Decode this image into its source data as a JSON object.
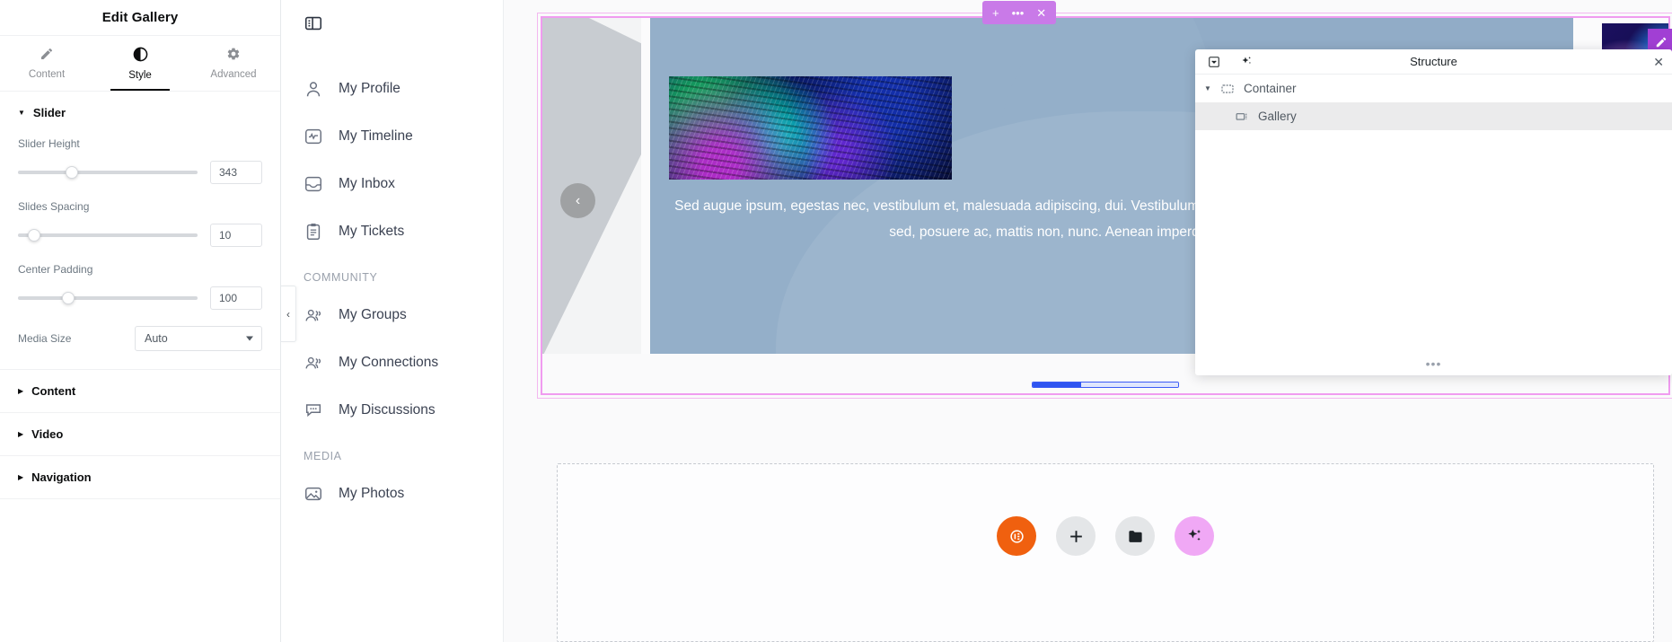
{
  "panel": {
    "title": "Edit Gallery",
    "tabs": [
      {
        "label": "Content",
        "icon": "pencil-icon",
        "active": false
      },
      {
        "label": "Style",
        "icon": "contrast-icon",
        "active": true
      },
      {
        "label": "Advanced",
        "icon": "gear-icon",
        "active": false
      }
    ],
    "sections": [
      {
        "name": "Slider",
        "expanded": true
      },
      {
        "name": "Content",
        "expanded": false
      },
      {
        "name": "Video",
        "expanded": false
      },
      {
        "name": "Navigation",
        "expanded": false
      }
    ],
    "slider_controls": [
      {
        "label": "Slider Height",
        "value": "343",
        "knob_pct": 30
      },
      {
        "label": "Slides Spacing",
        "value": "10",
        "knob_pct": 9
      },
      {
        "label": "Center Padding",
        "value": "100",
        "knob_pct": 28
      }
    ],
    "media_size": {
      "label": "Media Size",
      "value": "Auto"
    },
    "collapse_arrow": "‹"
  },
  "site_nav": {
    "toggle_icon": "sidebar-toggle-icon",
    "items": [
      {
        "type": "item",
        "label": "My Profile",
        "icon": "user-icon"
      },
      {
        "type": "item",
        "label": "My Timeline",
        "icon": "activity-icon"
      },
      {
        "type": "item",
        "label": "My Inbox",
        "icon": "inbox-icon"
      },
      {
        "type": "item",
        "label": "My Tickets",
        "icon": "clipboard-icon"
      },
      {
        "type": "group",
        "label": "COMMUNITY"
      },
      {
        "type": "item",
        "label": "My Groups",
        "icon": "users-icon"
      },
      {
        "type": "item",
        "label": "My Connections",
        "icon": "users-icon"
      },
      {
        "type": "item",
        "label": "My Discussions",
        "icon": "chat-icon"
      },
      {
        "type": "group",
        "label": "MEDIA"
      },
      {
        "type": "item",
        "label": "My Photos",
        "icon": "image-icon"
      }
    ]
  },
  "gallery_widget": {
    "toolbar": {
      "add": "+",
      "more": "•••",
      "close": "✕"
    },
    "edit_badge_icon": "pencil-icon",
    "prev_arrow": "‹",
    "caption": "Sed augue ipsum, egestas nec, vestibulum et, malesuada adipiscing, dui. Vestibulum dapibus nunc ac augue. Aenean tellus metus, bibendum sed, posuere ac, mattis non, nunc. Aenean imperdiet. Aenean imperdiet.",
    "pagination": {
      "total": 3,
      "active_index": 0
    }
  },
  "dropzone": {
    "fabs": [
      {
        "icon": "elementor-logo-icon",
        "style": "orange"
      },
      {
        "icon": "plus-icon",
        "style": "grey"
      },
      {
        "icon": "folder-icon",
        "style": "grey"
      },
      {
        "icon": "ai-sparkle-icon",
        "style": "violet"
      }
    ]
  },
  "navigator": {
    "title": "Structure",
    "header_icons": [
      "collapse-all-icon",
      "ai-sparkle-icon"
    ],
    "close_label": "✕",
    "tree": [
      {
        "label": "Container",
        "icon": "container-icon",
        "level": 0,
        "expanded": true,
        "selected": false
      },
      {
        "label": "Gallery",
        "icon": "gallery-icon",
        "level": 1,
        "expanded": false,
        "selected": true
      }
    ],
    "footer_handle": "•••"
  },
  "colors": {
    "accent_pink": "#f09bf0",
    "accent_violet": "#a13fd4",
    "slide_bg": "#7e9bba",
    "dot_active": "#2f55f0"
  }
}
